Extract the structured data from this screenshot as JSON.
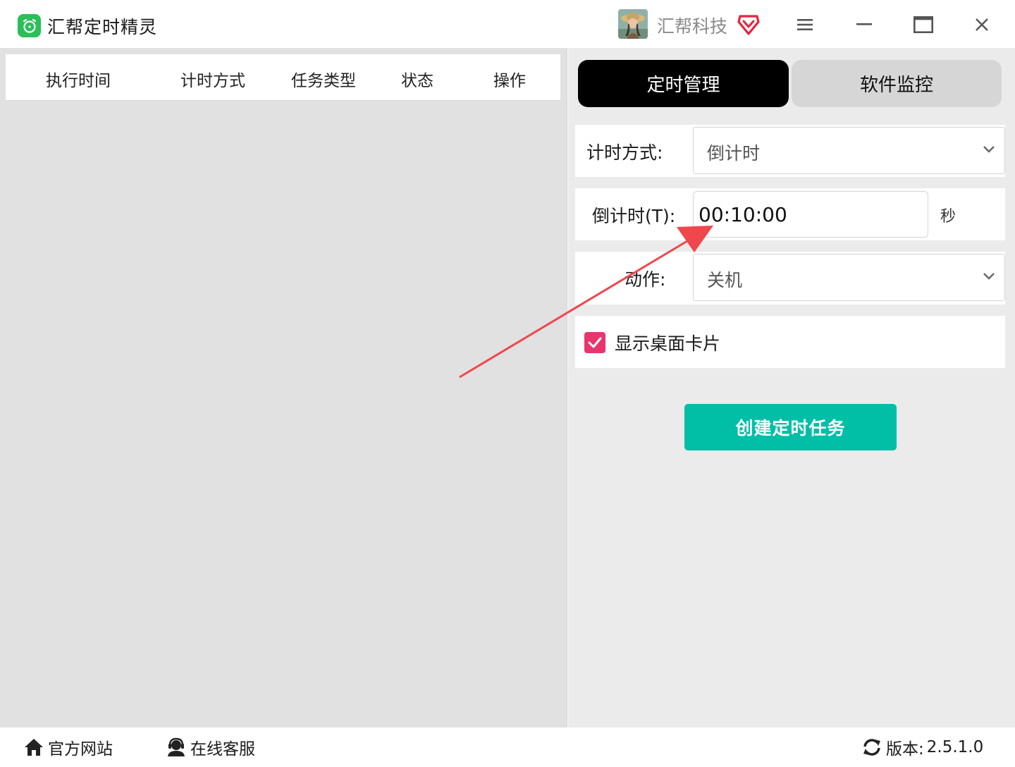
{
  "titlebar": {
    "app_name": "汇帮定时精灵",
    "company": "汇帮科技"
  },
  "task_table": {
    "columns": [
      "执行时间",
      "计时方式",
      "任务类型",
      "状态",
      "操作"
    ],
    "rows": []
  },
  "tabs": [
    {
      "label": "定时管理",
      "active": true
    },
    {
      "label": "软件监控",
      "active": false
    }
  ],
  "form": {
    "timing_mode": {
      "label": "计时方式:",
      "value": "倒计时"
    },
    "countdown": {
      "label": "倒计时(T):",
      "value": "00:10:00",
      "unit": "秒"
    },
    "action": {
      "label": "动作:",
      "value": "关机"
    },
    "show_desktop_card": {
      "label": "显示桌面卡片",
      "checked": true
    },
    "create_button": "创建定时任务"
  },
  "footer": {
    "website": "官方网站",
    "service": "在线客服",
    "version_label": "版本:",
    "version_value": "2.5.1.0"
  },
  "colors": {
    "accent_create": "#00bfa6",
    "checkbox": "#e8356d",
    "app_logo": "#2bbf5a",
    "vip_badge": "#e8243c",
    "annotation_arrow": "#f0464e"
  }
}
